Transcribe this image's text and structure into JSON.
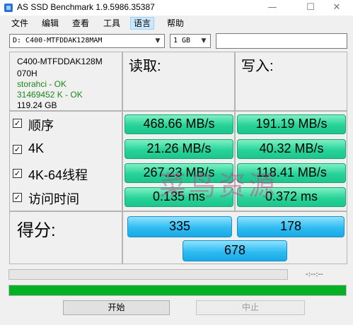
{
  "window": {
    "title": "AS SSD Benchmark 1.9.5986.35387",
    "minimize_glyph": "—",
    "maximize_glyph": "☐",
    "close_glyph": "✕"
  },
  "menu": [
    "文件",
    "编辑",
    "查看",
    "工具",
    "语言",
    "帮助"
  ],
  "drive_select": {
    "value": "D: C400-MTFDDAK128MAM"
  },
  "size_select": {
    "value": "1 GB"
  },
  "info": {
    "model": "C400-MTFDDAK128M",
    "firmware": "070H",
    "driver": "storahci - OK",
    "alignment": "31469452 K - OK",
    "capacity": "119.24 GB"
  },
  "columns": {
    "read": "读取:",
    "write": "写入:"
  },
  "rows": [
    {
      "label": "顺序",
      "read": "468.66 MB/s",
      "write": "191.19 MB/s"
    },
    {
      "label": "4K",
      "read": "21.26 MB/s",
      "write": "40.32 MB/s"
    },
    {
      "label": "4K-64线程",
      "read": "267.23 MB/s",
      "write": "118.41 MB/s"
    },
    {
      "label": "访问时间",
      "read": "0.135 ms",
      "write": "0.372 ms"
    }
  ],
  "score": {
    "label": "得分:",
    "read": "335",
    "write": "178",
    "total": "678"
  },
  "timer": "-:--:--",
  "progress": {
    "main_fraction": 1.0
  },
  "buttons": {
    "start": "开始",
    "stop": "中止"
  },
  "watermark": "菜鸟资源",
  "checkmark": "✓",
  "colors": {
    "result_green": "#27d39a",
    "score_blue": "#2fbcf2",
    "progress_green": "#06b025"
  }
}
